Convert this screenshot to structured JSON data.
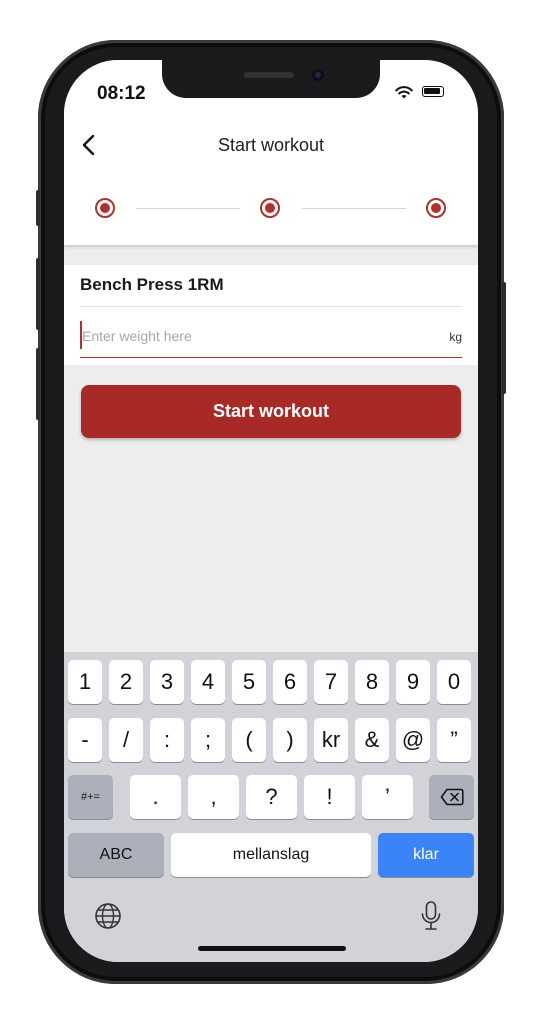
{
  "status_bar": {
    "time": "08:12"
  },
  "header": {
    "title": "Start workout",
    "back_icon": "chevron-left-icon"
  },
  "steps": [
    {
      "state": "active"
    },
    {
      "state": "active"
    },
    {
      "state": "active"
    }
  ],
  "exercise": {
    "name": "Bench Press 1RM",
    "weight_value": "",
    "weight_placeholder": "Enter weight here",
    "unit": "kg"
  },
  "actions": {
    "start_label": "Start workout"
  },
  "keyboard": {
    "row1": [
      "1",
      "2",
      "3",
      "4",
      "5",
      "6",
      "7",
      "8",
      "9",
      "0"
    ],
    "row2": [
      "-",
      "/",
      ":",
      ";",
      "(",
      ")",
      "kr",
      "&",
      "@",
      "”"
    ],
    "row3": [
      "#+=",
      ".",
      ",",
      "?",
      "!",
      "’"
    ],
    "abc_label": "ABC",
    "space_label": "mellanslag",
    "return_label": "klar"
  },
  "colors": {
    "accent": "#a82a26",
    "step": "#b0302b",
    "return_key": "#3a84f7"
  }
}
